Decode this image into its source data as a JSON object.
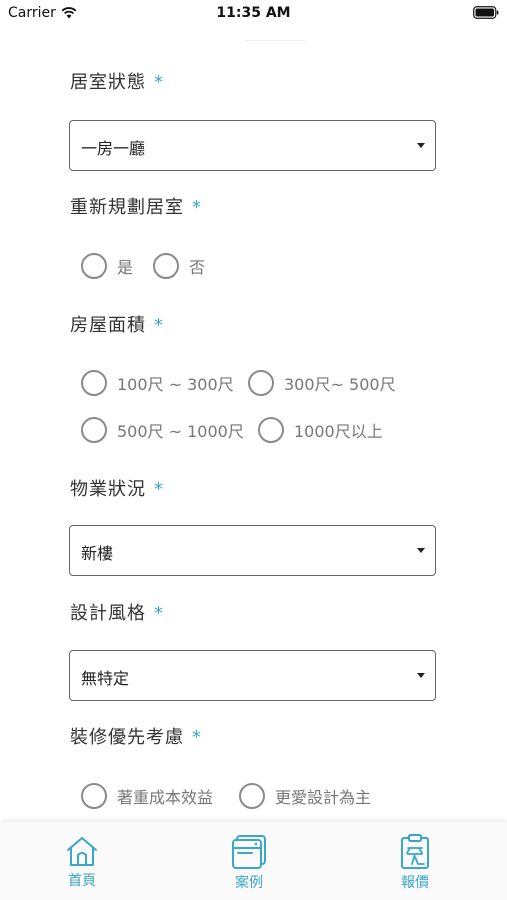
{
  "status_bar": {
    "carrier": "Carrier",
    "time": "11:35 AM"
  },
  "form": {
    "required_mark": "*",
    "room_status": {
      "label": "居室狀態",
      "value": "一房一廳"
    },
    "replan": {
      "label": "重新規劃居室",
      "options": [
        "是",
        "否"
      ]
    },
    "area": {
      "label": "房屋面積",
      "options": [
        "100尺 ~ 300尺",
        "300尺~ 500尺",
        "500尺 ~ 1000尺",
        "1000尺以上"
      ]
    },
    "property_status": {
      "label": "物業狀況",
      "value": "新樓"
    },
    "design_style": {
      "label": "設計風格",
      "value": "無特定"
    },
    "priority": {
      "label": "裝修優先考慮",
      "options": [
        "著重成本效益",
        "更愛設計為主"
      ]
    }
  },
  "tab_bar": {
    "accent_color": "#3aa6c9",
    "tabs": [
      {
        "label": "首頁",
        "icon": "home-icon"
      },
      {
        "label": "案例",
        "icon": "cases-icon"
      },
      {
        "label": "報價",
        "icon": "quote-icon"
      }
    ]
  }
}
